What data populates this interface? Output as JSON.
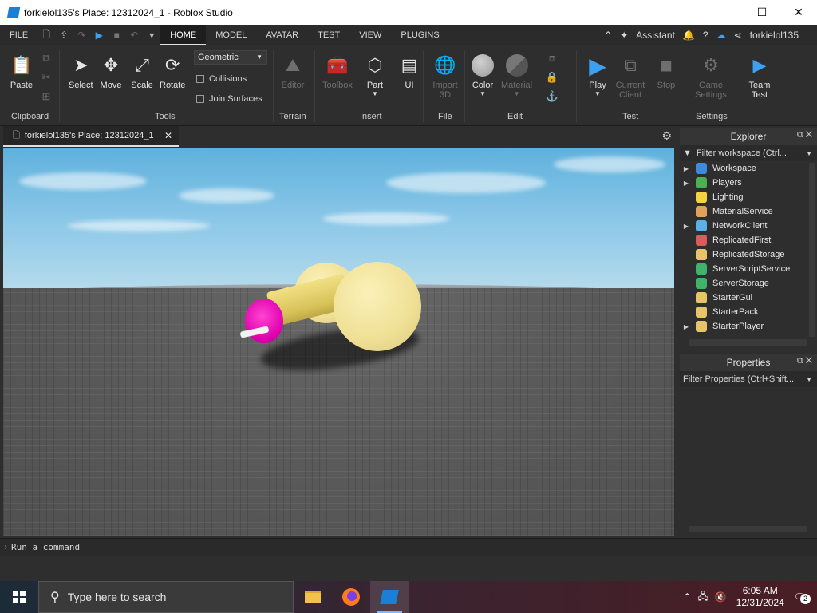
{
  "window": {
    "title": "forkielol135's Place: 12312024_1 - Roblox Studio",
    "minimize": "—",
    "maximize": "☐",
    "close": "✕"
  },
  "menubar": {
    "file": "FILE",
    "tabs": [
      "HOME",
      "MODEL",
      "AVATAR",
      "TEST",
      "VIEW",
      "PLUGINS"
    ],
    "active_tab": "HOME",
    "assistant": "Assistant",
    "username": "forkielol135"
  },
  "ribbon": {
    "clipboard": {
      "paste": "Paste",
      "group": "Clipboard"
    },
    "tools": {
      "select": "Select",
      "move": "Move",
      "scale": "Scale",
      "rotate": "Rotate",
      "mode_value": "Geometric",
      "collisions": "Collisions",
      "join_surfaces": "Join Surfaces",
      "group": "Tools"
    },
    "terrain": {
      "editor": "Editor",
      "group": "Terrain"
    },
    "insert": {
      "toolbox": "Toolbox",
      "part": "Part",
      "ui": "UI",
      "group": "Insert"
    },
    "file": {
      "import": "Import 3D",
      "group": "File"
    },
    "edit": {
      "color": "Color",
      "material": "Material",
      "group": "Edit"
    },
    "test": {
      "play": "Play",
      "current_client": "Current Client",
      "stop": "Stop",
      "group": "Test"
    },
    "settings": {
      "game_settings": "Game Settings",
      "group": "Settings"
    },
    "team": {
      "team_test": "Team Test"
    }
  },
  "document_tab": {
    "label": "forkielol135's Place: 12312024_1",
    "close": "✕"
  },
  "explorer": {
    "title": "Explorer",
    "filter_placeholder": "Filter workspace (Ctrl...",
    "items": [
      {
        "label": "Workspace",
        "expandable": true,
        "color": "#3d8bdb"
      },
      {
        "label": "Players",
        "expandable": true,
        "color": "#4caf50"
      },
      {
        "label": "Lighting",
        "expandable": false,
        "color": "#f5d442"
      },
      {
        "label": "MaterialService",
        "expandable": false,
        "color": "#e0a060"
      },
      {
        "label": "NetworkClient",
        "expandable": true,
        "color": "#5ab0e8"
      },
      {
        "label": "ReplicatedFirst",
        "expandable": false,
        "color": "#d95b5b"
      },
      {
        "label": "ReplicatedStorage",
        "expandable": false,
        "color": "#e7c36a"
      },
      {
        "label": "ServerScriptService",
        "expandable": false,
        "color": "#3fb36b"
      },
      {
        "label": "ServerStorage",
        "expandable": false,
        "color": "#3fb36b"
      },
      {
        "label": "StarterGui",
        "expandable": false,
        "color": "#e7c36a"
      },
      {
        "label": "StarterPack",
        "expandable": false,
        "color": "#e7c36a"
      },
      {
        "label": "StarterPlayer",
        "expandable": true,
        "color": "#e7c36a"
      }
    ]
  },
  "properties": {
    "title": "Properties",
    "filter_placeholder": "Filter Properties (Ctrl+Shift..."
  },
  "command_bar": {
    "placeholder": "Run a command"
  },
  "taskbar": {
    "search_placeholder": "Type here to search",
    "time": "6:05 AM",
    "date": "12/31/2024",
    "notification_count": "2"
  }
}
